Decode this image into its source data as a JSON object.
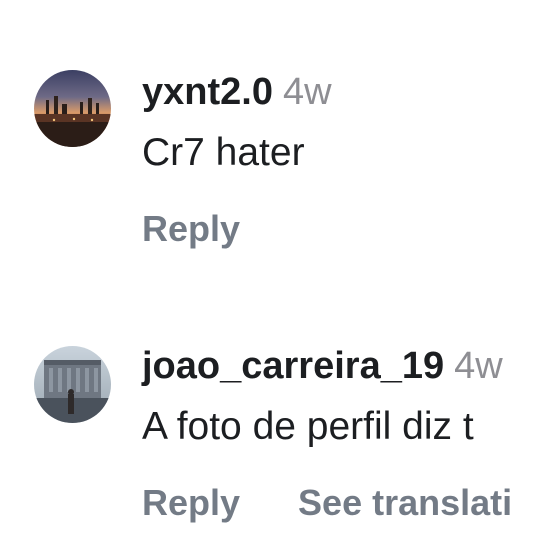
{
  "comments": [
    {
      "username": "yxnt2.0",
      "time": "4w",
      "text": "Cr7 hater",
      "reply_label": "Reply",
      "avatar_icon": "sunset-city-photo"
    },
    {
      "username": "joao_carreira_19",
      "time": "4w",
      "text": "A foto de perfil diz t",
      "reply_label": "Reply",
      "translate_label": "See translati",
      "avatar_icon": "building-plaza-photo"
    }
  ],
  "colors": {
    "username": "#1c1e21",
    "meta": "#8e8e93",
    "action": "#737b86"
  }
}
